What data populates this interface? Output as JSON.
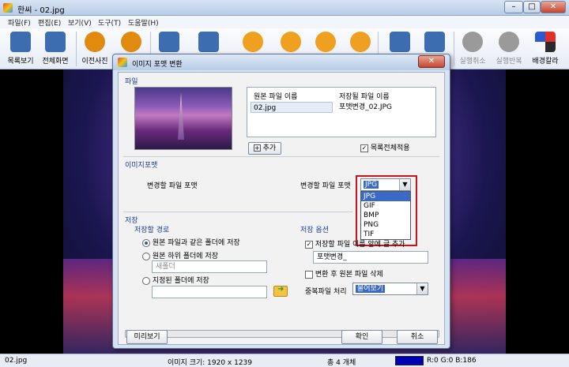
{
  "window": {
    "title": "한씨 - 02.jpg",
    "min": "–",
    "max": "□",
    "close": "✕"
  },
  "menu": [
    "파일(F)",
    "편집(E)",
    "보기(V)",
    "도구(T)",
    "도움말(H)"
  ],
  "toolbar": [
    {
      "label": "목록보기",
      "icon": "list-icon",
      "color": "#3b6db0"
    },
    {
      "label": "전체화면",
      "icon": "fullscreen-icon",
      "color": "#3b6db0"
    },
    {
      "label": "이전사진",
      "icon": "prev-arrow-icon",
      "color": "#e08a10"
    },
    {
      "label": "",
      "icon": "next-arrow-icon",
      "color": "#e08a10"
    },
    {
      "label": "",
      "icon": "print-icon",
      "color": "#3b6db0"
    },
    {
      "label": "",
      "icon": "save-icon",
      "color": "#3b6db0"
    },
    {
      "label": "",
      "icon": "rotate-left-icon",
      "color": "#f0a020"
    },
    {
      "label": "",
      "icon": "rotate-right-icon",
      "color": "#f0a020"
    },
    {
      "label": "",
      "icon": "flip-icon",
      "color": "#f0a020"
    },
    {
      "label": "",
      "icon": "warning-icon",
      "color": "#f0a020"
    },
    {
      "label": "",
      "icon": "convert-icon",
      "color": "#3b6db0"
    },
    {
      "label": "",
      "icon": "settings-icon",
      "color": "#3b6db0"
    },
    {
      "label": "실행취소",
      "icon": "undo-icon",
      "color": "#9a9a9a"
    },
    {
      "label": "실행반복",
      "icon": "redo-icon",
      "color": "#9a9a9a"
    },
    {
      "label": "배경칼라",
      "icon": "bg-color-icon",
      "color": "#222222"
    }
  ],
  "dialog": {
    "title": "이미지 포맷 변환",
    "close": "✕",
    "file_section": "파일",
    "col_source": "원본 파일 이름",
    "col_target": "저장될 파일 이름",
    "source_file": "02.jpg",
    "target_file": "포맷변경_02.JPG",
    "add_button": "추가",
    "apply_all": "목록전체적용",
    "format_section": "이미지포맷",
    "format_left_label": "변경할 파일 포맷",
    "format_label": "변경할 파일 포맷",
    "format_value": "JPG",
    "format_options": [
      "JPG",
      "GIF",
      "BMP",
      "PNG",
      "TIF"
    ],
    "save_section": "저장",
    "save_path_section": "저장할 경로",
    "opt_same_folder": "원본 파일과 같은 폴더에 저장",
    "opt_subfolder": "원본 하위 폴더에 저장",
    "subfolder_placeholder": "새폴더",
    "opt_custom_folder": "지정된 폴더에 저장",
    "save_options_section": "저장 옵션",
    "prefix_checkbox": "저장할 파일 이름 앞에 글 추가",
    "prefix_value": "포맷변경_",
    "delete_original": "변환 후 원본 파일 삭제",
    "duplicate_label": "중복파일 처리",
    "duplicate_value": "물어보기",
    "preview_button": "미리보기",
    "ok_button": "확인",
    "cancel_button": "취소"
  },
  "status": {
    "filename": "02.jpg",
    "image_size": "이미지 크기: 1920 x 1239",
    "total": "총 4 개체",
    "color_swatch": "#0000b3",
    "rgb": "R:0 G:0 B:186"
  }
}
